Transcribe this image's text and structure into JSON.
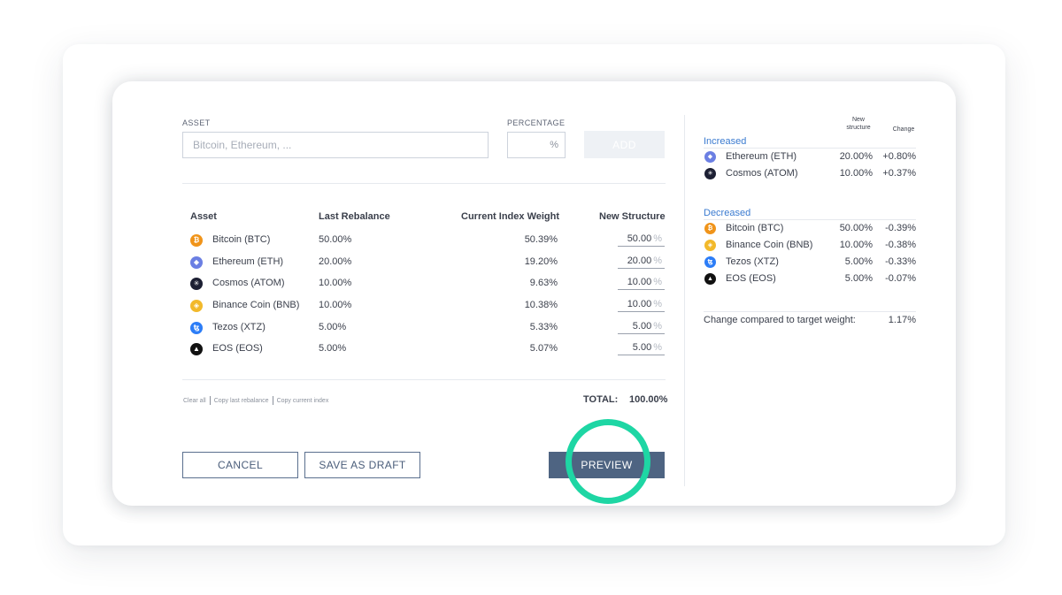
{
  "form": {
    "asset_label": "ASSET",
    "asset_placeholder": "Bitcoin, Ethereum, ...",
    "percentage_label": "PERCENTAGE",
    "percent_sign": "%",
    "add_label": "ADD"
  },
  "table": {
    "headers": {
      "asset": "Asset",
      "last_rebalance": "Last Rebalance",
      "current_index_weight": "Current Index Weight",
      "new_structure": "New Structure"
    },
    "rows": [
      {
        "name": "Bitcoin (BTC)",
        "icon": "bitcoin-icon",
        "glyph": "₿",
        "color": "#f0941a",
        "last": "50.00%",
        "current": "50.39%",
        "new": "50.00"
      },
      {
        "name": "Ethereum (ETH)",
        "icon": "ethereum-icon",
        "glyph": "◆",
        "color": "#6b7fe3",
        "last": "20.00%",
        "current": "19.20%",
        "new": "20.00"
      },
      {
        "name": "Cosmos (ATOM)",
        "icon": "cosmos-icon",
        "glyph": "✳",
        "color": "#1c1f33",
        "last": "10.00%",
        "current": "9.63%",
        "new": "10.00"
      },
      {
        "name": "Binance Coin (BNB)",
        "icon": "binance-icon",
        "glyph": "◈",
        "color": "#f2b92b",
        "last": "10.00%",
        "current": "10.38%",
        "new": "10.00"
      },
      {
        "name": "Tezos (XTZ)",
        "icon": "tezos-icon",
        "glyph": "ꜩ",
        "color": "#2c7df7",
        "last": "5.00%",
        "current": "5.33%",
        "new": "5.00"
      },
      {
        "name": "EOS (EOS)",
        "icon": "eos-icon",
        "glyph": "▲",
        "color": "#111111",
        "last": "5.00%",
        "current": "5.07%",
        "new": "5.00"
      }
    ],
    "pct_suffix": "%"
  },
  "footer_links": {
    "clear_all": "Clear all",
    "copy_last_rebalance": "Copy last rebalance",
    "copy_current_index": "Copy current index"
  },
  "total": {
    "label": "TOTAL:",
    "value": "100.00%"
  },
  "actions": {
    "cancel": "CANCEL",
    "save_draft": "SAVE AS DRAFT",
    "preview": "PREVIEW"
  },
  "summary": {
    "col_new_structure": "New\nstructure",
    "col_change": "Change",
    "increased_title": "Increased",
    "increased": [
      {
        "name": "Ethereum (ETH)",
        "icon": "ethereum-icon",
        "glyph": "◆",
        "color": "#6b7fe3",
        "new": "20.00%",
        "change": "+0.80%"
      },
      {
        "name": "Cosmos (ATOM)",
        "icon": "cosmos-icon",
        "glyph": "✳",
        "color": "#1c1f33",
        "new": "10.00%",
        "change": "+0.37%"
      }
    ],
    "decreased_title": "Decreased",
    "decreased": [
      {
        "name": "Bitcoin (BTC)",
        "icon": "bitcoin-icon",
        "glyph": "₿",
        "color": "#f0941a",
        "new": "50.00%",
        "change": "-0.39%"
      },
      {
        "name": "Binance Coin (BNB)",
        "icon": "binance-icon",
        "glyph": "◈",
        "color": "#f2b92b",
        "new": "10.00%",
        "change": "-0.38%"
      },
      {
        "name": "Tezos (XTZ)",
        "icon": "tezos-icon",
        "glyph": "ꜩ",
        "color": "#2c7df7",
        "new": "5.00%",
        "change": "-0.33%"
      },
      {
        "name": "EOS (EOS)",
        "icon": "eos-icon",
        "glyph": "▲",
        "color": "#111111",
        "new": "5.00%",
        "change": "-0.07%"
      }
    ],
    "change_label": "Change compared to target weight:",
    "change_value": "1.17%"
  },
  "colors": {
    "accent_blue": "#3b7bd0",
    "primary_button": "#4e6482",
    "highlight_ring": "#1ed6a4"
  }
}
